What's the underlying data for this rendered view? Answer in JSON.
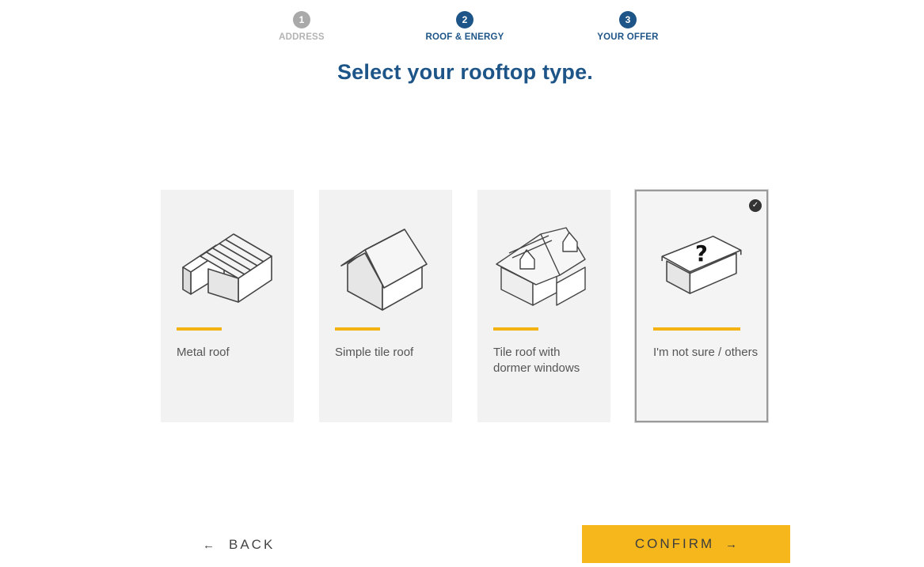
{
  "stepper": {
    "steps": [
      {
        "number": "1",
        "label": "ADDRESS",
        "state": "inactive"
      },
      {
        "number": "2",
        "label": "ROOF & ENERGY",
        "state": "active"
      },
      {
        "number": "3",
        "label": "YOUR OFFER",
        "state": "active"
      }
    ]
  },
  "title": "Select your rooftop type.",
  "options": [
    {
      "label": "Metal roof",
      "icon": "metal-roof-house-icon",
      "selected": false
    },
    {
      "label": "Simple tile roof",
      "icon": "simple-tile-roof-house-icon",
      "selected": false
    },
    {
      "label": "Tile roof with dormer windows",
      "icon": "dormer-roof-house-icon",
      "selected": false
    },
    {
      "label": "I'm not sure / others",
      "icon": "unknown-roof-house-icon",
      "selected": true
    }
  ],
  "footer": {
    "back_label": "BACK",
    "back_arrow": "←",
    "confirm_label": "CONFIRM",
    "confirm_arrow": "→"
  },
  "colors": {
    "primary": "#1e5588",
    "accent": "#f6b71c",
    "card_bg": "#f2f2f2"
  }
}
